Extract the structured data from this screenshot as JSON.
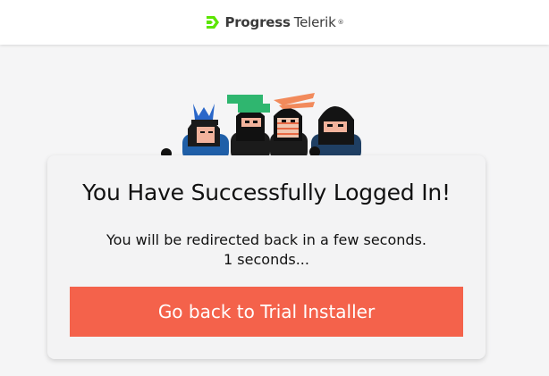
{
  "header": {
    "logo_icon": "progress-chevron-icon",
    "brand_primary": "Progress",
    "brand_secondary": "Telerik",
    "brand_mark": "®",
    "logo_color": "#5ce500"
  },
  "illustration": {
    "name": "ninja-team-illustration"
  },
  "card": {
    "title": "You Have Successfully Logged In!",
    "message": "You will be redirected back in a few seconds.",
    "countdown": "1 seconds...",
    "button_label": "Go back to Trial Installer"
  },
  "colors": {
    "accent": "#f4624b",
    "background": "#f5f5f6",
    "card_background": "#f3f3f4"
  }
}
